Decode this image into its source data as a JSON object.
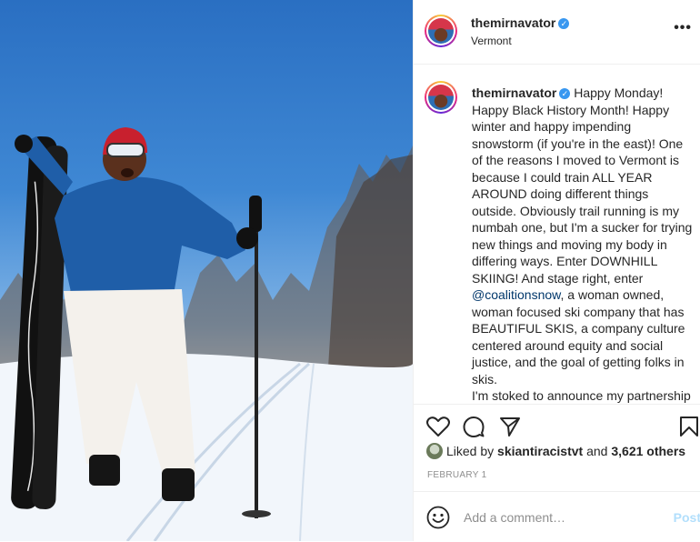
{
  "post": {
    "username": "themirnavator",
    "location": "Vermont",
    "more_icon": "more-options-icon"
  },
  "caption": {
    "username": "themirnavator",
    "text_before_mention": "Happy Monday! Happy Black History Month! Happy winter and happy impending snowstorm (if you're in the east)! One of the reasons I moved to Vermont is because I could train ALL YEAR AROUND doing different things outside. Obviously trail running is my numbah one, but I'm a sucker for trying new things and moving my body in differing ways. Enter DOWNHILL SKIING! And stage right, enter ",
    "mention": "@coalitionsnow",
    "text_after_mention": ", a woman owned, woman focused ski company that has BEAUTIFUL SKIS, a company culture centered around equity and social justice, and the goal of getting folks in skis.",
    "continuation": "I'm stoked to announce my partnership with Coalition Snow led"
  },
  "likes": {
    "prefix": "Liked by",
    "user": "skiantiracistvt",
    "joiner": "and",
    "count": "3,621 others"
  },
  "date": "FEBRUARY 1",
  "comment": {
    "placeholder": "Add a comment…",
    "post_label": "Post"
  },
  "colors": {
    "accent": "#3897f0",
    "mention": "#00376b",
    "post_disabled": "#b2dffc",
    "muted": "#8e8e8e"
  }
}
